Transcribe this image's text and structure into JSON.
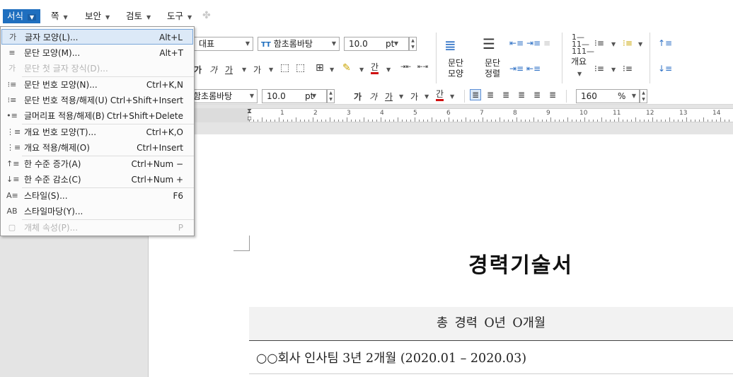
{
  "menubar": {
    "items": [
      {
        "label": "서식",
        "active": true
      },
      {
        "label": "쪽"
      },
      {
        "label": "보안"
      },
      {
        "label": "검토"
      },
      {
        "label": "도구"
      }
    ]
  },
  "toolbar": {
    "style_select": "대표",
    "font_select": "함초롬바탕",
    "font_icon": "TT",
    "size_value": "10.0",
    "size_unit": "pt",
    "para_shape_label": "문단\n모양",
    "para_align_label": "문단\n정렬",
    "outline_label": "개요",
    "glyph_ga": "가",
    "glyph_ga_underline": "가",
    "glyph_ga2": "가",
    "glyph_gan": "간"
  },
  "formatbar": {
    "font_select": "함초롬바탕",
    "size_value": "10.0",
    "size_unit": "pt",
    "line_spacing": "160",
    "line_spacing_unit": "%"
  },
  "ruler": {
    "numbers": [
      "1",
      "1",
      "2",
      "3",
      "4",
      "5",
      "6",
      "7",
      "8",
      "9",
      "10",
      "11",
      "12",
      "13",
      "14"
    ]
  },
  "dropdown": {
    "items": [
      {
        "icon": "char-shape-icon",
        "glyph": "가",
        "label": "글자 모양(L)...",
        "shortcut": "Alt+L",
        "highlight": true
      },
      {
        "icon": "para-shape-icon",
        "glyph": "≡",
        "label": "문단 모양(M)...",
        "shortcut": "Alt+T"
      },
      {
        "icon": "drop-cap-icon",
        "glyph": "가",
        "label": "문단 첫 글자 장식(D)...",
        "shortcut": "",
        "disabled": true
      },
      {
        "icon": "para-number-icon",
        "glyph": "⁝≡",
        "label": "문단 번호 모양(N)...",
        "shortcut": "Ctrl+K,N",
        "sep_before": true
      },
      {
        "icon": "para-number-toggle-icon",
        "glyph": "⁝≡",
        "label": "문단 번호 적용/해제(U)",
        "shortcut": "Ctrl+Shift+Insert"
      },
      {
        "icon": "bullet-toggle-icon",
        "glyph": "•≡",
        "label": "글머리표 적용/해제(B)",
        "shortcut": "Ctrl+Shift+Delete"
      },
      {
        "icon": "outline-number-icon",
        "glyph": "⋮≡",
        "label": "개요 번호 모양(T)...",
        "shortcut": "Ctrl+K,O",
        "sep_before": true
      },
      {
        "icon": "outline-toggle-icon",
        "glyph": "⋮≡",
        "label": "개요 적용/해제(O)",
        "shortcut": "Ctrl+Insert"
      },
      {
        "icon": "level-up-icon",
        "glyph": "↑≡",
        "label": "한 수준 증가(A)",
        "shortcut": "Ctrl+Num −",
        "sep_before": true
      },
      {
        "icon": "level-down-icon",
        "glyph": "↓≡",
        "label": "한 수준 감소(C)",
        "shortcut": "Ctrl+Num +"
      },
      {
        "icon": "style-icon",
        "glyph": "A≡",
        "label": "스타일(S)...",
        "shortcut": "F6",
        "sep_before": true
      },
      {
        "icon": "style-gallery-icon",
        "glyph": "AB",
        "label": "스타일마당(Y)...",
        "shortcut": ""
      },
      {
        "icon": "object-props-icon",
        "glyph": "▢",
        "label": "개체 속성(P)...",
        "shortcut": "P",
        "disabled": true,
        "sep_before": true
      }
    ]
  },
  "document": {
    "title": "경력기술서",
    "career_total": "총 경력 O년 O개월",
    "career_entry": "○○회사 인사팀 3년 2개월 (2020.01 – 2020.03)"
  }
}
